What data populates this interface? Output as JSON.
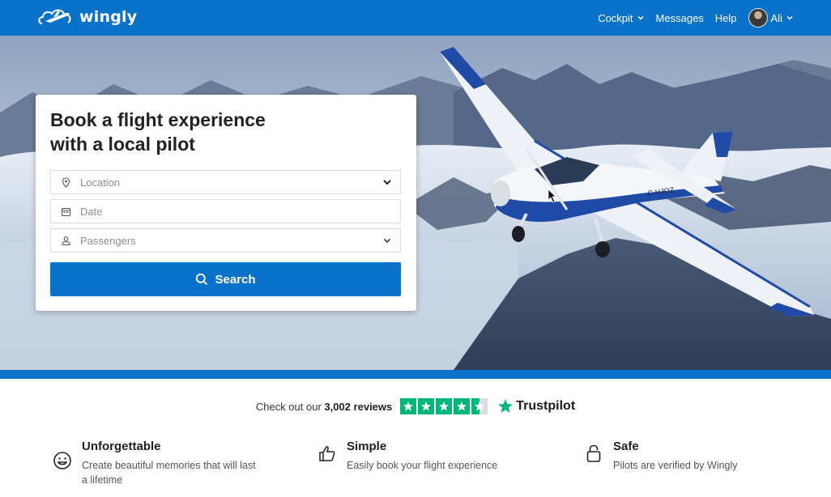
{
  "nav": {
    "brand": "wingly",
    "items": [
      {
        "label": "Cockpit",
        "has_dropdown": true
      },
      {
        "label": "Messages",
        "has_dropdown": false
      },
      {
        "label": "Help",
        "has_dropdown": false
      }
    ],
    "user": {
      "name": "Ali",
      "has_dropdown": true
    }
  },
  "hero": {
    "title_line1": "Book a flight experience",
    "title_line2": "with a local pilot",
    "plane_tail_mark": "C-HJOZ"
  },
  "form": {
    "location": {
      "placeholder": "Location",
      "icon": "map-pin-icon"
    },
    "date": {
      "placeholder": "Date",
      "icon": "calendar-icon"
    },
    "passengers": {
      "placeholder": "Passengers",
      "icon": "person-icon"
    },
    "search_label": "Search"
  },
  "reviews": {
    "prefix": "Check out our",
    "count": "3,002 reviews",
    "rating_stars": 4.5,
    "brand": "Trustpilot"
  },
  "features": [
    {
      "title": "Unforgettable",
      "desc": "Create beautiful memories that will last a lifetime",
      "icon": "smiley-icon"
    },
    {
      "title": "Simple",
      "desc": "Easily book your flight experience",
      "icon": "thumbs-up-icon"
    },
    {
      "title": "Safe",
      "desc": "Pilots are verified by Wingly",
      "icon": "lock-icon"
    }
  ],
  "colors": {
    "brand_blue": "#0b72c9",
    "trustpilot_green": "#00b67a"
  }
}
